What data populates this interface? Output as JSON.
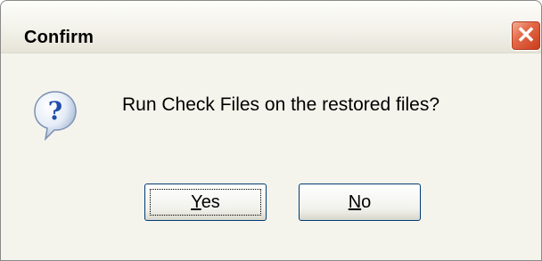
{
  "window": {
    "title": "Confirm",
    "close_symbol": "✕"
  },
  "dialog": {
    "icon": "question-icon",
    "message": "Run Check Files on the restored files?"
  },
  "buttons": {
    "yes": {
      "mnemonic": "Y",
      "rest": "es"
    },
    "no": {
      "mnemonic": "N",
      "rest": "o"
    }
  },
  "colors": {
    "close_button": "#d9532f",
    "icon_fill": "#dfe8f4",
    "icon_mark": "#1f4fa8",
    "button_border": "#003c74"
  }
}
